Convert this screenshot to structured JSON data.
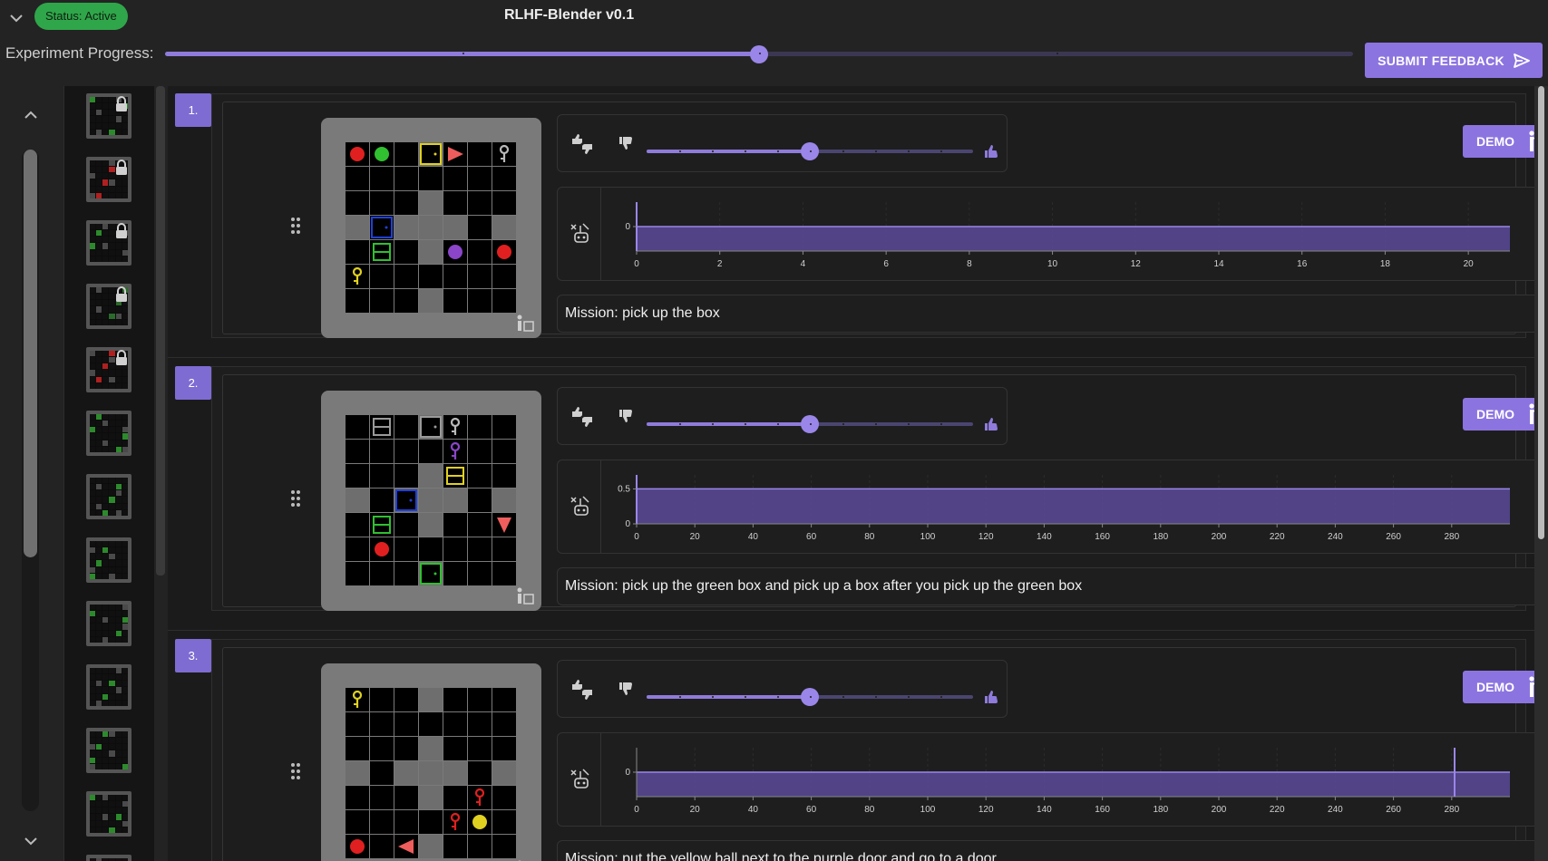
{
  "header": {
    "status_badge": "Status: Active",
    "title": "RLHF-Blender v0.1",
    "progress_label": "Experiment Progress:",
    "progress_value": 0.5,
    "progress_ticks": [
      0.25,
      0.5,
      0.75
    ],
    "submit_label": "SUBMIT FEEDBACK"
  },
  "thumbnails": [
    {
      "locked": true,
      "accent": "#2c8a2c"
    },
    {
      "locked": true,
      "accent": "#b02020"
    },
    {
      "locked": true,
      "accent": "#2c8a2c"
    },
    {
      "locked": true,
      "accent": "#2c6a2c"
    },
    {
      "locked": true,
      "accent": "#b02020"
    },
    {
      "locked": false,
      "accent": "#2c8a2c"
    },
    {
      "locked": false,
      "accent": "#2c8a2c"
    },
    {
      "locked": false,
      "accent": "#2c8a2c"
    },
    {
      "locked": false,
      "accent": "#2c8a2c"
    },
    {
      "locked": false,
      "accent": "#2c8a2c"
    },
    {
      "locked": false,
      "accent": "#2c8a2c"
    },
    {
      "locked": false,
      "accent": "#2c8a2c"
    },
    {
      "locked": false,
      "accent": "#2c8a2c"
    }
  ],
  "episodes": [
    {
      "number": "1.",
      "demo_label": "DEMO",
      "rating": 0.5,
      "mission": "Mission: pick up the box",
      "chart_data": {
        "type": "area",
        "x_ticks": [
          0,
          2,
          4,
          6,
          8,
          10,
          12,
          14,
          16,
          18,
          20
        ],
        "xlim": [
          0,
          21
        ],
        "y_ticks": [
          0
        ],
        "ylim": [
          -0.5,
          0.5
        ],
        "series": [
          {
            "values": [
              0
            ]
          }
        ],
        "markers": [
          0
        ]
      },
      "env": [
        {
          "cell": [
            0,
            0
          ],
          "obj": "ball",
          "color": "#e02020"
        },
        {
          "cell": [
            1,
            0
          ],
          "obj": "ball",
          "color": "#30c030"
        },
        {
          "cell": [
            3,
            0
          ],
          "obj": "door-open",
          "color": "#e0d020"
        },
        {
          "cell": [
            4,
            0
          ],
          "obj": "agent-right",
          "color": "#ef5d5d"
        },
        {
          "cell": [
            6,
            0
          ],
          "obj": "key",
          "color": "#b9b9b9"
        },
        {
          "cell": [
            1,
            3
          ],
          "obj": "door-open",
          "color": "#2040d8"
        },
        {
          "cell": [
            1,
            4
          ],
          "obj": "box",
          "color": "#30c030"
        },
        {
          "cell": [
            4,
            4
          ],
          "obj": "ball",
          "color": "#8a45c8"
        },
        {
          "cell": [
            6,
            4
          ],
          "obj": "ball",
          "color": "#e02020"
        },
        {
          "cell": [
            0,
            5
          ],
          "obj": "key",
          "color": "#e0d020"
        }
      ]
    },
    {
      "number": "2.",
      "demo_label": "DEMO",
      "rating": 0.5,
      "mission": "Mission: pick up the green box and pick up a box after you pick up the green box",
      "chart_data": {
        "type": "area",
        "x_ticks": [
          0,
          20,
          40,
          60,
          80,
          100,
          120,
          140,
          160,
          180,
          200,
          220,
          240,
          260,
          280
        ],
        "xlim": [
          0,
          300
        ],
        "y_ticks": [
          0,
          0.5
        ],
        "ylim": [
          0,
          0.7
        ],
        "series": [
          {
            "values": [
              0.5
            ]
          }
        ],
        "markers": [
          0
        ]
      },
      "env": [
        {
          "cell": [
            1,
            0
          ],
          "obj": "box",
          "color": "#9a9a9a"
        },
        {
          "cell": [
            3,
            0
          ],
          "obj": "door-open",
          "color": "#9a9a9a"
        },
        {
          "cell": [
            4,
            0
          ],
          "obj": "key",
          "color": "#b9b9b9"
        },
        {
          "cell": [
            4,
            1
          ],
          "obj": "key",
          "color": "#8a45c8"
        },
        {
          "cell": [
            4,
            2
          ],
          "obj": "box",
          "color": "#e0d020"
        },
        {
          "cell": [
            2,
            3
          ],
          "obj": "door-open",
          "color": "#2040d8"
        },
        {
          "cell": [
            1,
            4
          ],
          "obj": "box",
          "color": "#30c030"
        },
        {
          "cell": [
            6,
            4
          ],
          "obj": "agent-down",
          "color": "#ef5d5d"
        },
        {
          "cell": [
            1,
            5
          ],
          "obj": "ball",
          "color": "#e02020"
        },
        {
          "cell": [
            3,
            6
          ],
          "obj": "door-open",
          "color": "#30c030"
        }
      ]
    },
    {
      "number": "3.",
      "demo_label": "DEMO",
      "rating": 0.5,
      "mission": "Mission: put the yellow ball next to the purple door and go to a door",
      "chart_data": {
        "type": "area",
        "x_ticks": [
          0,
          20,
          40,
          60,
          80,
          100,
          120,
          140,
          160,
          180,
          200,
          220,
          240,
          260,
          280
        ],
        "xlim": [
          0,
          300
        ],
        "y_ticks": [
          0
        ],
        "ylim": [
          -0.5,
          0.5
        ],
        "series": [
          {
            "values": [
              0
            ]
          }
        ],
        "markers": [
          281
        ]
      },
      "env": [
        {
          "cell": [
            0,
            0
          ],
          "obj": "key",
          "color": "#e0d020"
        },
        {
          "cell": [
            5,
            4
          ],
          "obj": "key",
          "color": "#e02020"
        },
        {
          "cell": [
            4,
            5
          ],
          "obj": "key",
          "color": "#e02020"
        },
        {
          "cell": [
            5,
            5
          ],
          "obj": "ball",
          "color": "#e0d020"
        },
        {
          "cell": [
            0,
            6
          ],
          "obj": "ball",
          "color": "#e02020"
        },
        {
          "cell": [
            2,
            6
          ],
          "obj": "agent-left",
          "color": "#ef5d5d"
        }
      ]
    }
  ]
}
